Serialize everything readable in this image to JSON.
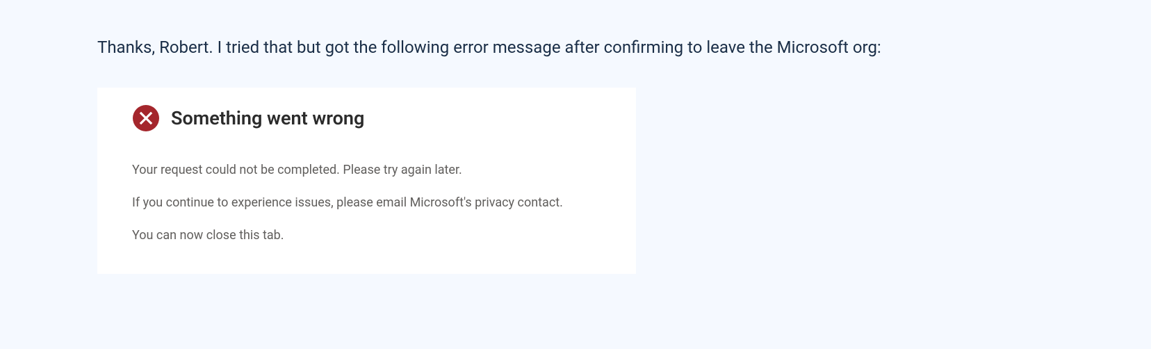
{
  "intro": "Thanks, Robert. I tried that but got the following error message after confirming to leave the Microsoft org:",
  "error": {
    "title": "Something went wrong",
    "line1": "Your request could not be completed. Please try again later.",
    "line2": "If you continue to experience issues, please email Microsoft's privacy contact.",
    "line3": "You can now close this tab."
  },
  "colors": {
    "pageBg": "#f5f9ff",
    "introText": "#1a2e47",
    "errorIcon": "#a4262c",
    "errorTitle": "#2b2b2b",
    "errorBody": "#605e5c"
  }
}
